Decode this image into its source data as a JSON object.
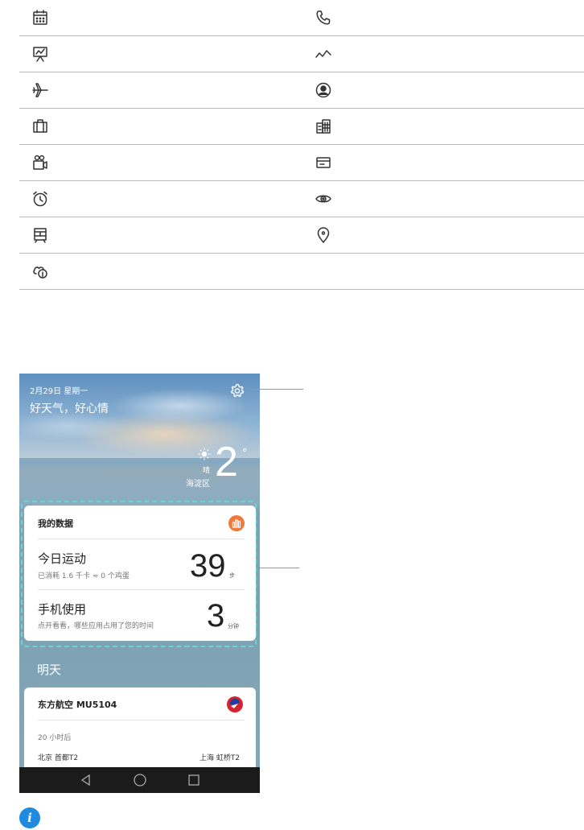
{
  "phone": {
    "date": "2月29日 星期一",
    "greeting": "好天气，好心情",
    "weather": {
      "condition": "晴",
      "location": "海淀区",
      "temperature": "2",
      "degree": "°"
    },
    "my_data": {
      "title": "我的数据",
      "exercise": {
        "title": "今日运动",
        "subtitle": "已消耗 1.6 千卡 ≈ 0 个鸡蛋",
        "value": "39",
        "unit": "步"
      },
      "phone_usage": {
        "title": "手机使用",
        "subtitle": "点开看看，哪些应用占用了您的时间",
        "value": "3",
        "unit": "分钟"
      }
    },
    "tomorrow_label": "明天",
    "flight": {
      "title": "东方航空  MU5104",
      "eta": "20 小时后",
      "from": "北京 首都T2",
      "to": "上海 虹桥T2"
    }
  },
  "icons": {
    "rows": [
      [
        "calendar-icon",
        "phone-icon"
      ],
      [
        "presentation-icon",
        "trend-icon"
      ],
      [
        "airplane-icon",
        "contact-icon"
      ],
      [
        "luggage-icon",
        "hotel-icon"
      ],
      [
        "movie-icon",
        "card-icon"
      ],
      [
        "alarm-icon",
        "eye-icon"
      ],
      [
        "train-icon",
        "location-icon"
      ],
      [
        "weather-alert-icon",
        ""
      ]
    ]
  },
  "colors": {
    "callout": "#47b9b9",
    "data_icon": "#ee7a3c",
    "info_icon": "#1f8ae0",
    "dashed_frame": "#6fd3d3"
  }
}
